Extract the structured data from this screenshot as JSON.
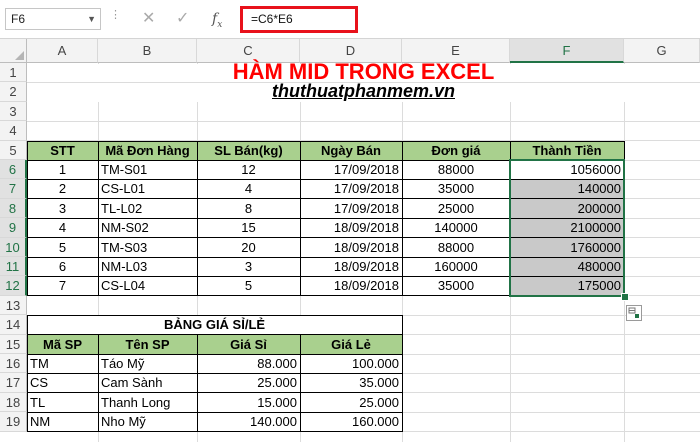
{
  "formula_bar": {
    "name_box": "F6",
    "formula": "=C6*E6",
    "icons": [
      "cancel-icon",
      "enter-icon",
      "function-icon"
    ]
  },
  "columns": [
    "A",
    "B",
    "C",
    "D",
    "E",
    "F",
    "G"
  ],
  "rows": [
    "1",
    "2",
    "3",
    "4",
    "5",
    "6",
    "7",
    "8",
    "9",
    "10",
    "11",
    "12",
    "13",
    "14",
    "15",
    "16",
    "17",
    "18",
    "19"
  ],
  "title": "HÀM MID TRONG EXCEL",
  "subtitle": "thuthuatphanmem.vn",
  "main_table": {
    "headers": [
      "STT",
      "Mã Đơn Hàng",
      "SL Bán(kg)",
      "Ngày Bán",
      "Đơn giá",
      "Thành Tiền"
    ],
    "rows": [
      [
        "1",
        "TM-S01",
        "12",
        "17/09/2018",
        "88000",
        "1056000"
      ],
      [
        "2",
        "CS-L01",
        "4",
        "17/09/2018",
        "35000",
        "140000"
      ],
      [
        "3",
        "TL-L02",
        "8",
        "17/09/2018",
        "25000",
        "200000"
      ],
      [
        "4",
        "NM-S02",
        "15",
        "18/09/2018",
        "140000",
        "2100000"
      ],
      [
        "5",
        "TM-S03",
        "20",
        "18/09/2018",
        "88000",
        "1760000"
      ],
      [
        "6",
        "NM-L03",
        "3",
        "18/09/2018",
        "160000",
        "480000"
      ],
      [
        "7",
        "CS-L04",
        "5",
        "18/09/2018",
        "35000",
        "175000"
      ]
    ]
  },
  "price_table": {
    "title": "BẢNG GIÁ SỈ/LẺ",
    "headers": [
      "Mã SP",
      "Tên SP",
      "Giá Sỉ",
      "Giá Lẻ"
    ],
    "rows": [
      [
        "TM",
        "Táo Mỹ",
        "88.000",
        "100.000"
      ],
      [
        "CS",
        "Cam Sành",
        "25.000",
        "35.000"
      ],
      [
        "TL",
        "Thanh Long",
        "15.000",
        "25.000"
      ],
      [
        "NM",
        "Nho Mỹ",
        "140.000",
        "160.000"
      ]
    ]
  },
  "selection": {
    "active_cell": "F6",
    "range": "F6:F12"
  },
  "colors": {
    "header_fill": "#a9d08e",
    "title": "#ff0000",
    "selection": "#217346",
    "gray_fill": "#c9c9c9",
    "formula_highlight": "#e8111b"
  }
}
